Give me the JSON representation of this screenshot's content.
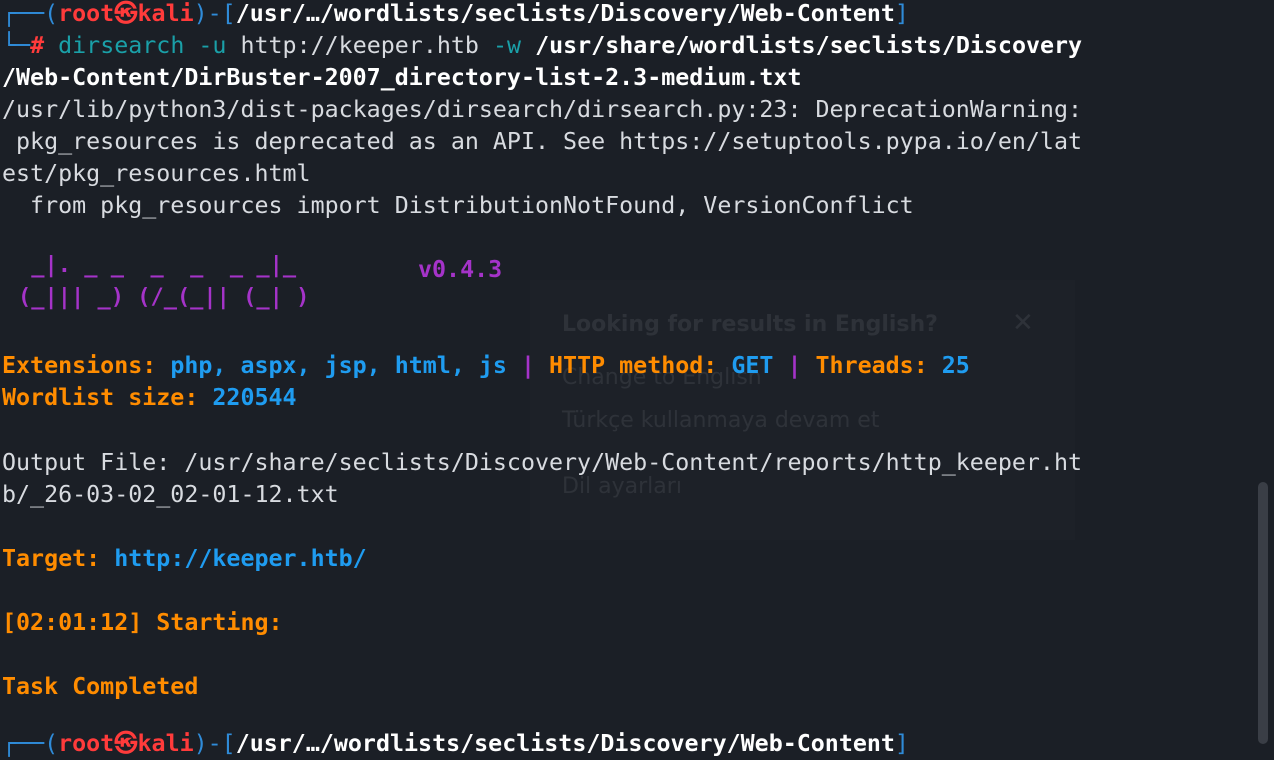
{
  "prompt1": {
    "user": "root",
    "host": "kali",
    "cwd": "/usr/…/wordlists/seclists/Discovery/Web-Content"
  },
  "command": {
    "hash": "#",
    "tool": "dirsearch",
    "flag_u": "-u",
    "url": "http://keeper.htb",
    "flag_w": "-w",
    "wordlist_1": "/usr/share/wordlists/seclists/Discovery",
    "wordlist_2": "/Web-Content/DirBuster-2007_directory-list-2.3-medium.txt"
  },
  "warning": {
    "line1": "/usr/lib/python3/dist-packages/dirsearch/dirsearch.py:23: DeprecationWarning:",
    "line2": " pkg_resources is deprecated as an API. See https://setuptools.pypa.io/en/lat",
    "line3": "est/pkg_resources.html",
    "line4": "  from pkg_resources import DistributionNotFound, VersionConflict"
  },
  "banner": {
    "art_line1": " _|. _ _  _  _  _ _|_",
    "art_line2": "(_||| _) (/_(_|| (_| )",
    "version": "v0.4.3"
  },
  "config": {
    "extensions_label": "Extensions: ",
    "extensions_value": "php, aspx, jsp, html, js",
    "sep": " | ",
    "method_label": "HTTP method: ",
    "method_value": "GET",
    "threads_label": "Threads: ",
    "threads_value": "25",
    "wordlist_label": "Wordlist size: ",
    "wordlist_value": "220544"
  },
  "output": {
    "line1": "Output File: /usr/share/seclists/Discovery/Web-Content/reports/http_keeper.ht",
    "line2": "b/_26-03-02_02-01-12.txt"
  },
  "target": {
    "label": "Target: ",
    "value": "http://keeper.htb/"
  },
  "starting": "[02:01:12] Starting:",
  "completed": "Task Completed",
  "prompt2": {
    "user": "root",
    "host": "kali",
    "cwd": "/usr/…/wordlists/seclists/Discovery/Web-Content"
  },
  "ghost_popup": {
    "title": "Looking for results in English?",
    "opt1": "Change to English",
    "opt2": "Türkçe kullanmaya devam et",
    "opt3": "Dil ayarları"
  },
  "colors": {
    "background": "#1b1f26",
    "prompt_blue": "#2f8bd8",
    "root_red": "#ff3b3b",
    "label_orange": "#ff8c00",
    "value_blue": "#1f9cf0",
    "banner_purple": "#a533c9"
  }
}
